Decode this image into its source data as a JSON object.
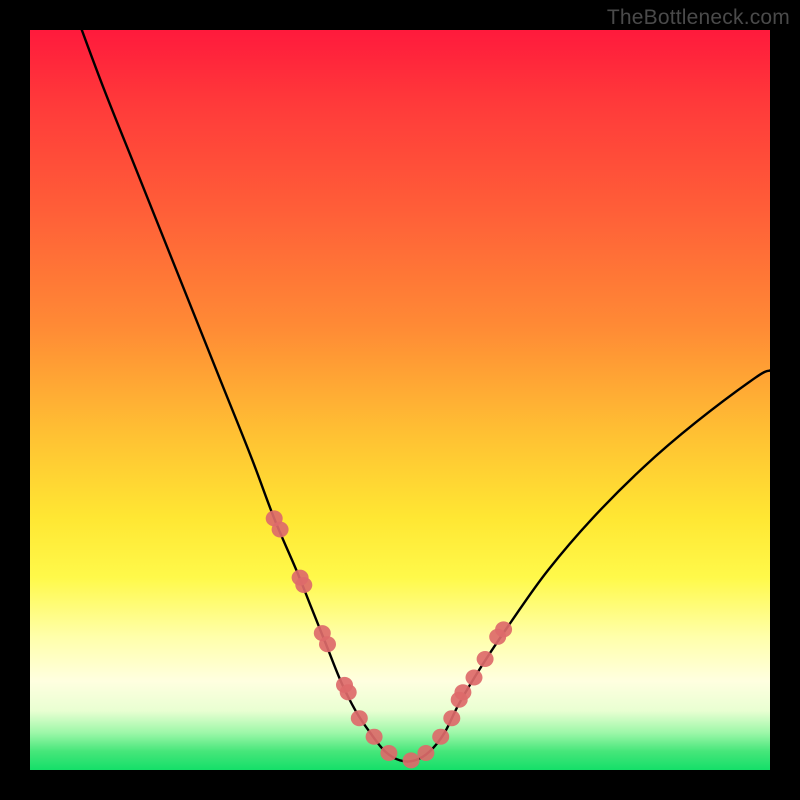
{
  "watermark": "TheBottleneck.com",
  "chart_data": {
    "type": "line",
    "title": "",
    "xlabel": "",
    "ylabel": "",
    "xlim": [
      0,
      100
    ],
    "ylim": [
      0,
      100
    ],
    "series": [
      {
        "name": "bottleneck-curve",
        "x": [
          7,
          10,
          14,
          18,
          22,
          26,
          30,
          33,
          36,
          38,
          40,
          42,
          44,
          46,
          48,
          50,
          52,
          54,
          56,
          58,
          61,
          65,
          70,
          76,
          83,
          90,
          98,
          100
        ],
        "values": [
          100,
          92,
          82,
          72,
          62,
          52,
          42,
          34,
          27,
          22,
          17,
          12,
          8,
          5,
          2.5,
          1.3,
          1.3,
          2.5,
          5,
          9,
          14,
          20,
          27,
          34,
          41,
          47,
          53,
          54
        ]
      }
    ],
    "markers": {
      "name": "highlight-dots",
      "x": [
        33.0,
        33.8,
        36.5,
        37.0,
        39.5,
        40.2,
        42.5,
        43.0,
        44.5,
        46.5,
        48.5,
        51.5,
        53.5,
        55.5,
        57.0,
        58.0,
        58.5,
        60.0,
        61.5,
        63.2,
        64.0
      ],
      "values": [
        34.0,
        32.5,
        26.0,
        25.0,
        18.5,
        17.0,
        11.5,
        10.5,
        7.0,
        4.5,
        2.3,
        1.3,
        2.3,
        4.5,
        7.0,
        9.5,
        10.5,
        12.5,
        15.0,
        18.0,
        19.0
      ]
    },
    "gradient_stops": [
      {
        "pos": 0,
        "color": "#ff1a3c"
      },
      {
        "pos": 0.55,
        "color": "#ffc233"
      },
      {
        "pos": 0.82,
        "color": "#ffffaa"
      },
      {
        "pos": 1.0,
        "color": "#14df69"
      }
    ]
  }
}
